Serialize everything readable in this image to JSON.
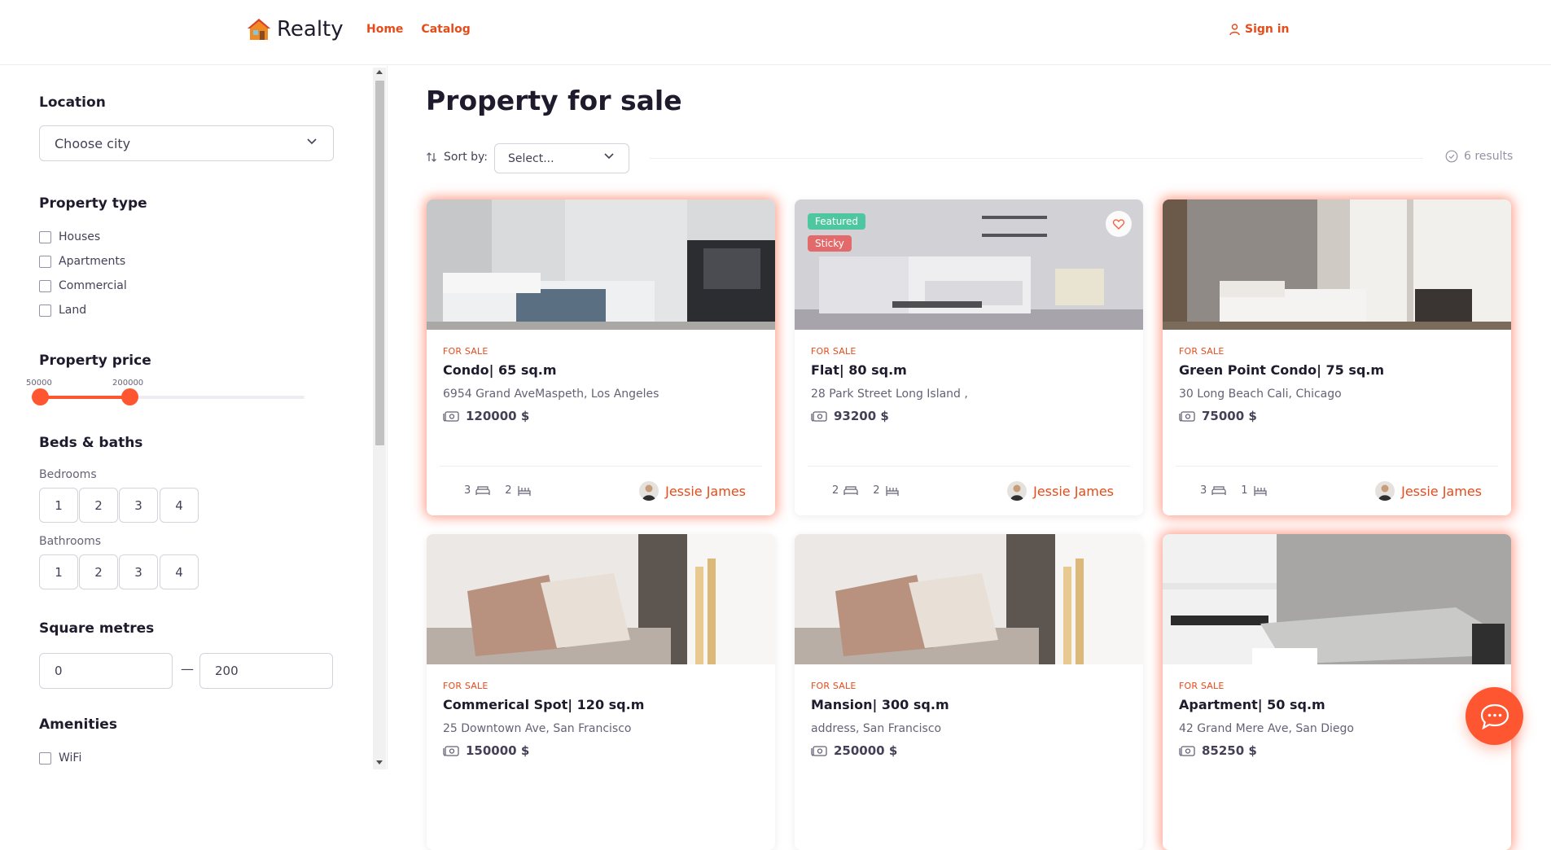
{
  "header": {
    "logo_text": "Realty",
    "nav": [
      "Home",
      "Catalog"
    ],
    "signin_label": "Sign in"
  },
  "sidebar": {
    "location": {
      "title": "Location",
      "placeholder": "Choose city"
    },
    "property_type": {
      "title": "Property type",
      "options": [
        "Houses",
        "Apartments",
        "Commercial",
        "Land"
      ]
    },
    "price": {
      "title": "Property price",
      "min_label": "50000",
      "max_label": "200000",
      "range_min": 50000,
      "range_max": 200000
    },
    "beds_baths": {
      "title": "Beds & baths",
      "bedrooms_label": "Bedrooms",
      "bedrooms": [
        "1",
        "2",
        "3",
        "4"
      ],
      "bathrooms_label": "Bathrooms",
      "bathrooms": [
        "1",
        "2",
        "3",
        "4"
      ]
    },
    "square": {
      "title": "Square metres",
      "min": "0",
      "max": "200",
      "separator": "—"
    },
    "amenities": {
      "title": "Amenities",
      "options": [
        "WiFi"
      ]
    }
  },
  "main": {
    "title": "Property for sale",
    "sort_label": "Sort by:",
    "sort_value": "Select...",
    "results": "6 results",
    "cards": [
      {
        "tag": "FOR SALE",
        "title": "Condo| 65 sq.m",
        "address": "6954 Grand AveMaspeth, Los Angeles",
        "price": "120000 $",
        "beds": "3",
        "baths": "2",
        "agent": "Jessie James"
      },
      {
        "tag": "FOR SALE",
        "title": "Flat| 80 sq.m",
        "address": "28 Park Street Long Island ,",
        "price": "93200 $",
        "beds": "2",
        "baths": "2",
        "agent": "Jessie James",
        "badges": [
          "Featured",
          "Sticky"
        ]
      },
      {
        "tag": "FOR SALE",
        "title": "Green Point Condo| 75 sq.m",
        "address": "30 Long Beach Cali, Chicago",
        "price": "75000 $",
        "beds": "3",
        "baths": "1",
        "agent": "Jessie James"
      },
      {
        "tag": "FOR SALE",
        "title": "Commerical Spot| 120 sq.m",
        "address": "25 Downtown Ave, San Francisco",
        "price": "150000 $"
      },
      {
        "tag": "FOR SALE",
        "title": "Mansion| 300 sq.m",
        "address": "address, San Francisco",
        "price": "250000 $"
      },
      {
        "tag": "FOR SALE",
        "title": "Apartment| 50 sq.m",
        "address": "42 Grand Mere Ave, San Diego",
        "price": "85250 $"
      }
    ]
  },
  "colors": {
    "accent": "#fd5631",
    "accent_text": "#e64b1b",
    "featured_badge": "#4ec7a1",
    "sticky_badge": "#e26a6a"
  }
}
